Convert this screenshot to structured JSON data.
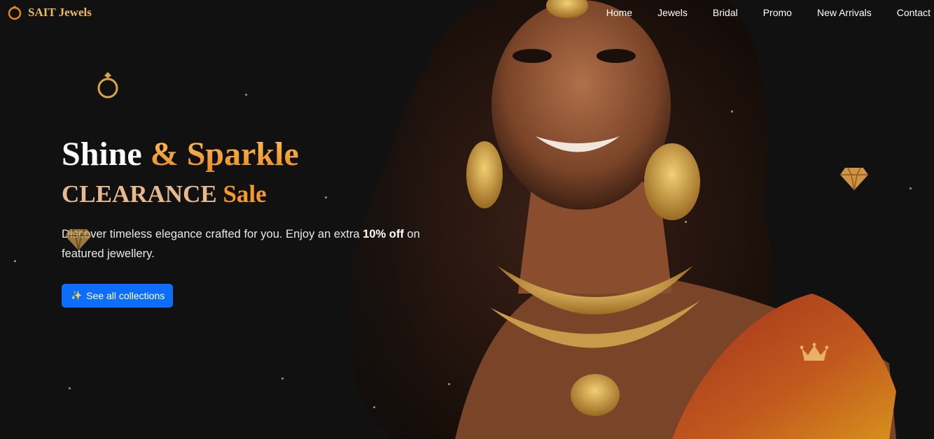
{
  "brand": {
    "name": "SAIT Jewels",
    "icon": "ring-icon"
  },
  "nav": {
    "items": [
      {
        "label": "Home"
      },
      {
        "label": "Jewels"
      },
      {
        "label": "Bridal"
      },
      {
        "label": "Promo"
      },
      {
        "label": "New Arrivals"
      },
      {
        "label": "Contact"
      }
    ]
  },
  "hero": {
    "title_main": "Shine",
    "title_accent": "& Sparkle",
    "subtitle_main": "CLEARANCE",
    "subtitle_accent": "Sale",
    "desc_before": "Discover timeless elegance crafted for you. Enjoy an extra",
    "desc_bold": "10% off",
    "desc_after": "on featured jewellery.",
    "cta_label": "See all collections",
    "cta_icon": "sparkles-icon"
  },
  "colors": {
    "background": "#111111",
    "brand_gold": "#f0b860",
    "accent_orange": "#f59a26",
    "cta_blue": "#0d6efd"
  }
}
